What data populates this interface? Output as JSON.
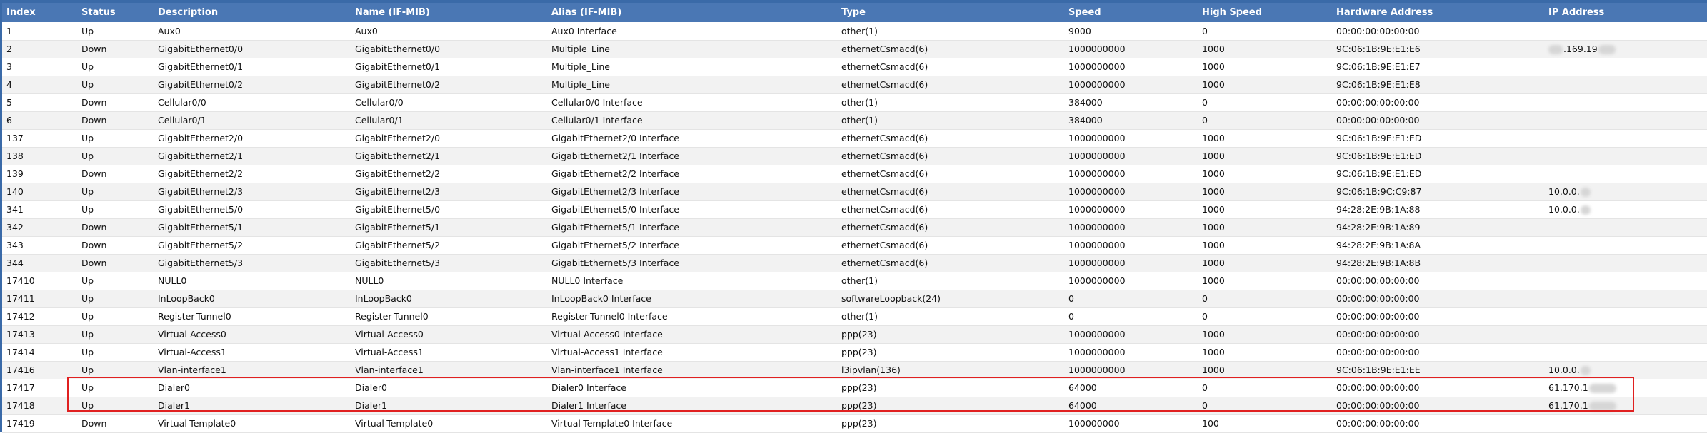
{
  "table": {
    "columns": [
      "Index",
      "Status",
      "Description",
      "Name (IF-MIB)",
      "Alias (IF-MIB)",
      "Type",
      "Speed",
      "High Speed",
      "Hardware Address",
      "IP Address"
    ],
    "rows": [
      [
        "1",
        "Up",
        "Aux0",
        "Aux0",
        "Aux0 Interface",
        "other(1)",
        "9000",
        "0",
        "00:00:00:00:00:00",
        ""
      ],
      [
        "2",
        "Down",
        "GigabitEthernet0/0",
        "GigabitEthernet0/0",
        "Multiple_Line",
        "ethernetCsmacd(6)",
        "1000000000",
        "1000",
        "9C:06:1B:9E:E1:E6",
        ".169.19"
      ],
      [
        "3",
        "Up",
        "GigabitEthernet0/1",
        "GigabitEthernet0/1",
        "Multiple_Line",
        "ethernetCsmacd(6)",
        "1000000000",
        "1000",
        "9C:06:1B:9E:E1:E7",
        ""
      ],
      [
        "4",
        "Up",
        "GigabitEthernet0/2",
        "GigabitEthernet0/2",
        "Multiple_Line",
        "ethernetCsmacd(6)",
        "1000000000",
        "1000",
        "9C:06:1B:9E:E1:E8",
        ""
      ],
      [
        "5",
        "Down",
        "Cellular0/0",
        "Cellular0/0",
        "Cellular0/0 Interface",
        "other(1)",
        "384000",
        "0",
        "00:00:00:00:00:00",
        ""
      ],
      [
        "6",
        "Down",
        "Cellular0/1",
        "Cellular0/1",
        "Cellular0/1 Interface",
        "other(1)",
        "384000",
        "0",
        "00:00:00:00:00:00",
        ""
      ],
      [
        "137",
        "Up",
        "GigabitEthernet2/0",
        "GigabitEthernet2/0",
        "GigabitEthernet2/0 Interface",
        "ethernetCsmacd(6)",
        "1000000000",
        "1000",
        "9C:06:1B:9E:E1:ED",
        ""
      ],
      [
        "138",
        "Up",
        "GigabitEthernet2/1",
        "GigabitEthernet2/1",
        "GigabitEthernet2/1 Interface",
        "ethernetCsmacd(6)",
        "1000000000",
        "1000",
        "9C:06:1B:9E:E1:ED",
        ""
      ],
      [
        "139",
        "Down",
        "GigabitEthernet2/2",
        "GigabitEthernet2/2",
        "GigabitEthernet2/2 Interface",
        "ethernetCsmacd(6)",
        "1000000000",
        "1000",
        "9C:06:1B:9E:E1:ED",
        ""
      ],
      [
        "140",
        "Up",
        "GigabitEthernet2/3",
        "GigabitEthernet2/3",
        "GigabitEthernet2/3 Interface",
        "ethernetCsmacd(6)",
        "1000000000",
        "1000",
        "9C:06:1B:9C:C9:87",
        "10.0.0."
      ],
      [
        "341",
        "Up",
        "GigabitEthernet5/0",
        "GigabitEthernet5/0",
        "GigabitEthernet5/0 Interface",
        "ethernetCsmacd(6)",
        "1000000000",
        "1000",
        "94:28:2E:9B:1A:88",
        "10.0.0."
      ],
      [
        "342",
        "Down",
        "GigabitEthernet5/1",
        "GigabitEthernet5/1",
        "GigabitEthernet5/1 Interface",
        "ethernetCsmacd(6)",
        "1000000000",
        "1000",
        "94:28:2E:9B:1A:89",
        ""
      ],
      [
        "343",
        "Down",
        "GigabitEthernet5/2",
        "GigabitEthernet5/2",
        "GigabitEthernet5/2 Interface",
        "ethernetCsmacd(6)",
        "1000000000",
        "1000",
        "94:28:2E:9B:1A:8A",
        ""
      ],
      [
        "344",
        "Down",
        "GigabitEthernet5/3",
        "GigabitEthernet5/3",
        "GigabitEthernet5/3 Interface",
        "ethernetCsmacd(6)",
        "1000000000",
        "1000",
        "94:28:2E:9B:1A:8B",
        ""
      ],
      [
        "17410",
        "Up",
        "NULL0",
        "NULL0",
        "NULL0 Interface",
        "other(1)",
        "1000000000",
        "1000",
        "00:00:00:00:00:00",
        ""
      ],
      [
        "17411",
        "Up",
        "InLoopBack0",
        "InLoopBack0",
        "InLoopBack0 Interface",
        "softwareLoopback(24)",
        "0",
        "0",
        "00:00:00:00:00:00",
        ""
      ],
      [
        "17412",
        "Up",
        "Register-Tunnel0",
        "Register-Tunnel0",
        "Register-Tunnel0 Interface",
        "other(1)",
        "0",
        "0",
        "00:00:00:00:00:00",
        ""
      ],
      [
        "17413",
        "Up",
        "Virtual-Access0",
        "Virtual-Access0",
        "Virtual-Access0 Interface",
        "ppp(23)",
        "1000000000",
        "1000",
        "00:00:00:00:00:00",
        ""
      ],
      [
        "17414",
        "Up",
        "Virtual-Access1",
        "Virtual-Access1",
        "Virtual-Access1 Interface",
        "ppp(23)",
        "1000000000",
        "1000",
        "00:00:00:00:00:00",
        ""
      ],
      [
        "17416",
        "Up",
        "Vlan-interface1",
        "Vlan-interface1",
        "Vlan-interface1 Interface",
        "l3ipvlan(136)",
        "1000000000",
        "1000",
        "9C:06:1B:9E:E1:EE",
        "10.0.0."
      ],
      [
        "17417",
        "Up",
        "Dialer0",
        "Dialer0",
        "Dialer0 Interface",
        "ppp(23)",
        "64000",
        "0",
        "00:00:00:00:00:00",
        "61.170.1"
      ],
      [
        "17418",
        "Up",
        "Dialer1",
        "Dialer1",
        "Dialer1 Interface",
        "ppp(23)",
        "64000",
        "0",
        "00:00:00:00:00:00",
        "61.170.1"
      ],
      [
        "17419",
        "Down",
        "Virtual-Template0",
        "Virtual-Template0",
        "Virtual-Template0 Interface",
        "ppp(23)",
        "100000000",
        "100",
        "00:00:00:00:00:00",
        ""
      ]
    ]
  },
  "highlight_color": "#e02020",
  "header_color": "#4a77b4"
}
